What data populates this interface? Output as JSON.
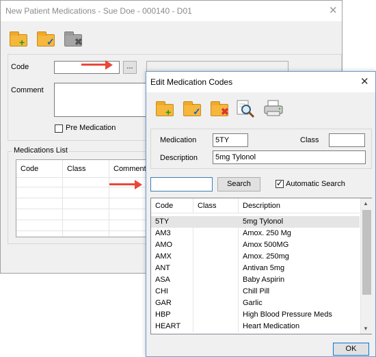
{
  "back_window": {
    "title": "New Patient Medications - Sue Doe - 000140 - D01",
    "toolbar": {
      "icons": [
        "folder-add-icon",
        "folder-save-icon",
        "folder-delete-icon"
      ]
    },
    "code_label": "Code",
    "code_value": "",
    "browse_label": "...",
    "comment_label": "Comment",
    "comment_value": "",
    "pre_med_label": "Pre Medication",
    "pre_med_checked": false,
    "med_list_label": "Medications List",
    "columns": [
      "Code",
      "Class",
      "Comment"
    ]
  },
  "dialog": {
    "title": "Edit Medication Codes",
    "toolbar": {
      "icons": [
        "folder-add-icon",
        "folder-save-icon",
        "folder-delete-icon",
        "magnify-icon",
        "print-icon"
      ]
    },
    "medication_label": "Medication",
    "medication_value": "5TY",
    "class_label": "Class",
    "class_value": "",
    "description_label": "Description",
    "description_value": "5mg Tylonol",
    "search_value": "",
    "search_button": "Search",
    "auto_search_label": "Automatic Search",
    "auto_search_checked": true,
    "columns": [
      "Code",
      "Class",
      "Description"
    ],
    "rows": [
      {
        "code": "5TY",
        "class": "",
        "description": "5mg Tylonol"
      },
      {
        "code": "AM3",
        "class": "",
        "description": "Amox. 250 Mg"
      },
      {
        "code": "AMO",
        "class": "",
        "description": "Amox 500MG"
      },
      {
        "code": "AMX",
        "class": "",
        "description": "Amox. 250mg"
      },
      {
        "code": "ANT",
        "class": "",
        "description": "Antivan 5mg"
      },
      {
        "code": "ASA",
        "class": "",
        "description": "Baby Aspirin"
      },
      {
        "code": "CHI",
        "class": "",
        "description": "Chill Pill"
      },
      {
        "code": "GAR",
        "class": "",
        "description": "Garlic"
      },
      {
        "code": "HBP",
        "class": "",
        "description": "High Blood Pressure Meds"
      },
      {
        "code": "HEART",
        "class": "",
        "description": "Heart Medication"
      }
    ],
    "ok_button": "OK"
  },
  "colors": {
    "accent_arrow": "#e8483b",
    "selection": "#e5e5e5",
    "dialog_border": "#6b9bd1"
  }
}
